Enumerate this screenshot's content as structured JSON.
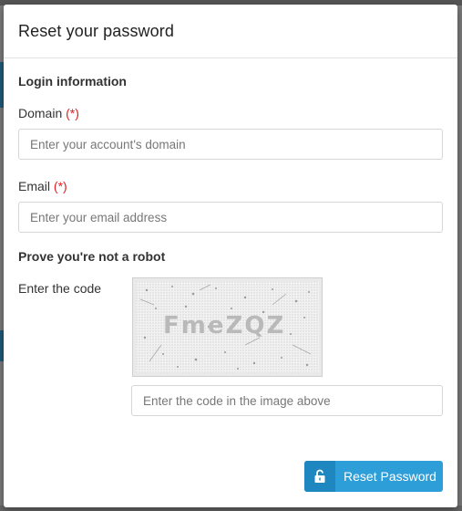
{
  "modal": {
    "title": "Reset your password"
  },
  "login_section": {
    "title": "Login information",
    "domain": {
      "label": "Domain",
      "required_mark": "(*)",
      "value": "",
      "placeholder": "Enter your account's domain"
    },
    "email": {
      "label": "Email",
      "required_mark": "(*)",
      "value": "",
      "placeholder": "Enter your email address"
    }
  },
  "robot_section": {
    "title": "Prove you're not a robot",
    "code_label": "Enter the code",
    "captcha_text": "FmeZQZ",
    "code_input": {
      "value": "",
      "placeholder": "Enter the code in the image above"
    }
  },
  "actions": {
    "reset_label": "Reset Password",
    "reset_icon": "unlock-icon"
  },
  "colors": {
    "accent": "#2d9ed8",
    "accent_dark": "#1e87bf",
    "required": "#e02020"
  }
}
